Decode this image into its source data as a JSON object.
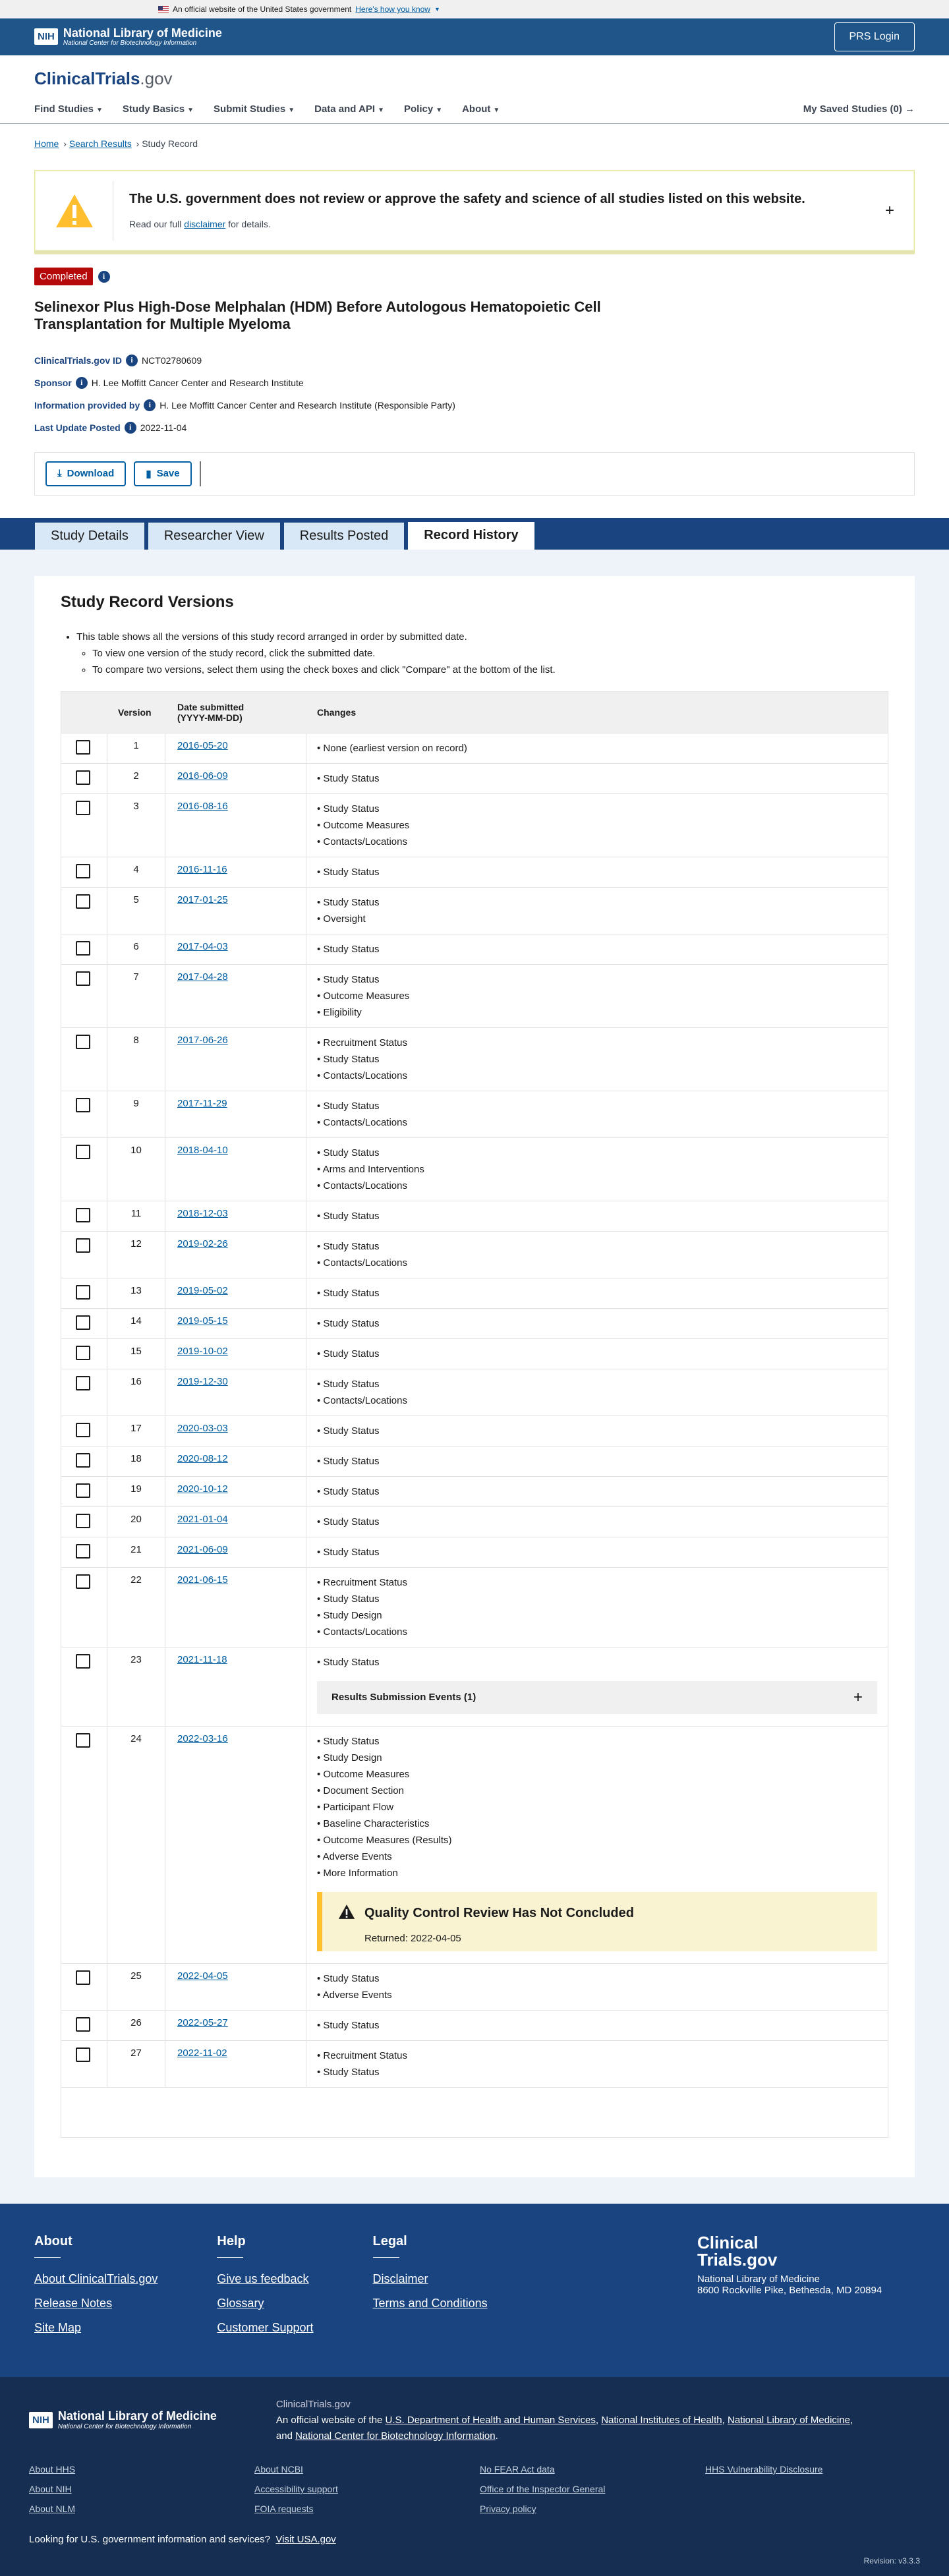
{
  "gov_banner": {
    "text": "An official website of the United States government",
    "link": "Here's how you know"
  },
  "nlm_bar": {
    "nih": "NIH",
    "title": "National Library of Medicine",
    "subtitle": "National Center for Biotechnology Information",
    "prs_login": "PRS Login"
  },
  "header": {
    "logo_main": "ClinicalTrials",
    "logo_suffix": ".gov",
    "nav": [
      "Find Studies",
      "Study Basics",
      "Submit Studies",
      "Data and API",
      "Policy",
      "About"
    ],
    "saved": "My Saved Studies (0)"
  },
  "breadcrumb": {
    "home": "Home",
    "search": "Search Results",
    "current": "Study Record"
  },
  "notice": {
    "title": "The U.S. government does not review or approve the safety and science of all studies listed on this website.",
    "pre": "Read our full ",
    "link": "disclaimer",
    "post": " for details."
  },
  "study": {
    "status": "Completed",
    "title": "Selinexor Plus High-Dose Melphalan (HDM) Before Autologous Hematopoietic Cell Transplantation for Multiple Myeloma",
    "id_label": "ClinicalTrials.gov ID",
    "id": "NCT02780609",
    "sponsor_label": "Sponsor",
    "sponsor": "H. Lee Moffitt Cancer Center and Research Institute",
    "info_label": "Information provided by",
    "info": "H. Lee Moffitt Cancer Center and Research Institute (Responsible Party)",
    "updated_label": "Last Update Posted",
    "updated": "2022-11-04"
  },
  "actions": {
    "download": "Download",
    "save": "Save"
  },
  "tabs": [
    "Study Details",
    "Researcher View",
    "Results Posted",
    "Record History"
  ],
  "versions": {
    "heading": "Study Record Versions",
    "intro": "This table shows all the versions of this study record arranged in order by submitted date.",
    "sub1": "To view one version of the study record, click the submitted date.",
    "sub2": "To compare two versions, select them using the check boxes and click \"Compare\" at the bottom of the list.",
    "col_version": "Version",
    "col_date": "Date submitted",
    "col_date_fmt": "(YYYY-MM-DD)",
    "col_changes": "Changes",
    "rse_label": "Results Submission Events (1)",
    "qc_title": "Quality Control Review Has Not Concluded",
    "qc_returned": "Returned: 2022-04-05",
    "rows": [
      {
        "v": "1",
        "d": "2016-05-20",
        "c": [
          "None (earliest version on record)"
        ]
      },
      {
        "v": "2",
        "d": "2016-06-09",
        "c": [
          "Study Status"
        ]
      },
      {
        "v": "3",
        "d": "2016-08-16",
        "c": [
          "Study Status",
          "Outcome Measures",
          "Contacts/Locations"
        ]
      },
      {
        "v": "4",
        "d": "2016-11-16",
        "c": [
          "Study Status"
        ]
      },
      {
        "v": "5",
        "d": "2017-01-25",
        "c": [
          "Study Status",
          "Oversight"
        ]
      },
      {
        "v": "6",
        "d": "2017-04-03",
        "c": [
          "Study Status"
        ]
      },
      {
        "v": "7",
        "d": "2017-04-28",
        "c": [
          "Study Status",
          "Outcome Measures",
          "Eligibility"
        ]
      },
      {
        "v": "8",
        "d": "2017-06-26",
        "c": [
          "Recruitment Status",
          "Study Status",
          "Contacts/Locations"
        ]
      },
      {
        "v": "9",
        "d": "2017-11-29",
        "c": [
          "Study Status",
          "Contacts/Locations"
        ]
      },
      {
        "v": "10",
        "d": "2018-04-10",
        "c": [
          "Study Status",
          "Arms and Interventions",
          "Contacts/Locations"
        ]
      },
      {
        "v": "11",
        "d": "2018-12-03",
        "c": [
          "Study Status"
        ]
      },
      {
        "v": "12",
        "d": "2019-02-26",
        "c": [
          "Study Status",
          "Contacts/Locations"
        ]
      },
      {
        "v": "13",
        "d": "2019-05-02",
        "c": [
          "Study Status"
        ]
      },
      {
        "v": "14",
        "d": "2019-05-15",
        "c": [
          "Study Status"
        ]
      },
      {
        "v": "15",
        "d": "2019-10-02",
        "c": [
          "Study Status"
        ]
      },
      {
        "v": "16",
        "d": "2019-12-30",
        "c": [
          "Study Status",
          "Contacts/Locations"
        ]
      },
      {
        "v": "17",
        "d": "2020-03-03",
        "c": [
          "Study Status"
        ]
      },
      {
        "v": "18",
        "d": "2020-08-12",
        "c": [
          "Study Status"
        ]
      },
      {
        "v": "19",
        "d": "2020-10-12",
        "c": [
          "Study Status"
        ]
      },
      {
        "v": "20",
        "d": "2021-01-04",
        "c": [
          "Study Status"
        ]
      },
      {
        "v": "21",
        "d": "2021-06-09",
        "c": [
          "Study Status"
        ]
      },
      {
        "v": "22",
        "d": "2021-06-15",
        "c": [
          "Recruitment Status",
          "Study Status",
          "Study Design",
          "Contacts/Locations"
        ]
      },
      {
        "v": "23",
        "d": "2021-11-18",
        "c": [
          "Study Status"
        ],
        "rse": true
      },
      {
        "v": "24",
        "d": "2022-03-16",
        "c": [
          "Study Status",
          "Study Design",
          "Outcome Measures",
          "Document Section",
          "Participant Flow",
          "Baseline Characteristics",
          "Outcome Measures (Results)",
          "Adverse Events",
          "More Information"
        ],
        "qc": true
      },
      {
        "v": "25",
        "d": "2022-04-05",
        "c": [
          "Study Status",
          "Adverse Events"
        ]
      },
      {
        "v": "26",
        "d": "2022-05-27",
        "c": [
          "Study Status"
        ]
      },
      {
        "v": "27",
        "d": "2022-11-02",
        "c": [
          "Recruitment Status",
          "Study Status"
        ]
      }
    ]
  },
  "footer": {
    "about": {
      "title": "About",
      "links": [
        "About ClinicalTrials.gov",
        "Release Notes",
        "Site Map"
      ]
    },
    "help": {
      "title": "Help",
      "links": [
        "Give us feedback",
        "Glossary",
        "Customer Support"
      ]
    },
    "legal": {
      "title": "Legal",
      "links": [
        "Disclaimer",
        "Terms and Conditions"
      ]
    },
    "addr_logo1": "Clinical",
    "addr_logo2": "Trials.gov",
    "addr1": "National Library of Medicine",
    "addr2": "8600 Rockville Pike, Bethesda, MD 20894"
  },
  "nlm_footer": {
    "site": "ClinicalTrials.gov",
    "official_pre": "An official website of the ",
    "hhs": "U.S. Department of Health and Human Services",
    "nih": "National Institutes of Health",
    "nlm": "National Library of Medicine",
    "and": "and",
    "ncbi": "National Center for Biotechnology Information",
    "links": [
      "About HHS",
      "About NCBI",
      "No FEAR Act data",
      "HHS Vulnerability Disclosure",
      "About NIH",
      "Accessibility support",
      "Office of the Inspector General",
      "",
      "About NLM",
      "FOIA requests",
      "Privacy policy",
      ""
    ],
    "look_pre": "Looking for U.S. government information and services?",
    "look_link": "Visit USA.gov",
    "revision": "Revision: v3.3.3"
  }
}
